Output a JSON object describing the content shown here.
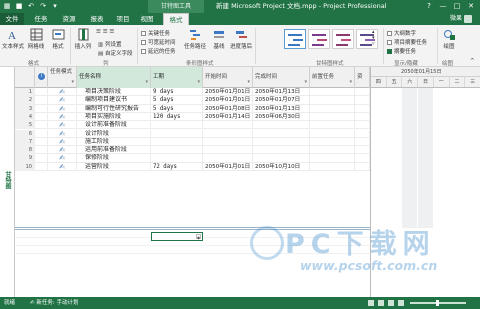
{
  "window": {
    "title": "新建 Microsoft Project 文档.mpp - Project Professional",
    "context_tools": "甘特图工具",
    "controls": [
      "?",
      "—",
      "□",
      "✕"
    ]
  },
  "tabs": [
    {
      "label": "文件"
    },
    {
      "label": "任务"
    },
    {
      "label": "资源"
    },
    {
      "label": "报表"
    },
    {
      "label": "项目"
    },
    {
      "label": "视图"
    },
    {
      "label": "格式"
    }
  ],
  "user": {
    "name": "微果"
  },
  "ribbon": {
    "text_styles": "文本样式",
    "gridlines": "网格线",
    "format": "格式",
    "insert_column": "插入列",
    "column_settings": "列设置",
    "custom_fields": "自定义字段",
    "critical_tasks": "关键任务",
    "slack": "可宽延时间",
    "late_tasks": "延迟的任务",
    "task_path": "任务路径",
    "baseline": "基线",
    "slippage": "进度落后",
    "outline_number": "大纲数字",
    "project_summary": "项目摘要任务",
    "summary_tasks": "摘要任务",
    "drawing": "绘图",
    "groups": {
      "format": "格式",
      "columns": "列",
      "bar_styles": "条形图样式",
      "gantt_styles": "甘特图样式",
      "show_hide": "显示/隐藏",
      "drawings": "绘图"
    },
    "checks": {
      "critical_tasks": false,
      "slack": false,
      "late_tasks": false,
      "outline_number": false,
      "project_summary": false,
      "summary_tasks": true
    }
  },
  "sidebar": {
    "view_label": "甘特图"
  },
  "table": {
    "headers": {
      "mode": "任务模式",
      "name": "任务名称",
      "duration": "工期",
      "start": "开始时间",
      "finish": "完成时间",
      "predecessors": "前置任务",
      "resources": "资"
    },
    "rows": [
      {
        "num": "1",
        "name": "项目决策阶段",
        "duration": "9 days",
        "start": "2050年01月01日",
        "finish": "2050年01月13日"
      },
      {
        "num": "2",
        "name": "编制项目建议书",
        "duration": "5 days",
        "start": "2050年01月01日",
        "finish": "2050年01月07日"
      },
      {
        "num": "3",
        "name": "编制可行性研究报告",
        "duration": "5 days",
        "start": "2050年01月08日",
        "finish": "2050年01月13日"
      },
      {
        "num": "4",
        "name": "项目实施阶段",
        "duration": "120 days",
        "start": "2050年01月14日",
        "finish": "2050年06月30日"
      },
      {
        "num": "5",
        "name": "设计前准备阶段",
        "duration": "",
        "start": "",
        "finish": ""
      },
      {
        "num": "6",
        "name": "设计阶段",
        "duration": "",
        "start": "",
        "finish": ""
      },
      {
        "num": "7",
        "name": "施工阶段",
        "duration": "",
        "start": "",
        "finish": ""
      },
      {
        "num": "8",
        "name": "运用前准备阶段",
        "duration": "",
        "start": "",
        "finish": ""
      },
      {
        "num": "9",
        "name": "保修阶段",
        "duration": "",
        "start": "",
        "finish": ""
      },
      {
        "num": "10",
        "name": "运营阶段",
        "duration": "72 days",
        "start": "2050年01月01日",
        "finish": "2050年10月10日"
      }
    ]
  },
  "gantt": {
    "top_header": "2050年01月15日",
    "day_letters": [
      "四",
      "五",
      "六",
      "日",
      "一",
      "二",
      "三"
    ]
  },
  "status": {
    "ready": "就绪",
    "new_tasks": "新任务: 手动计划"
  },
  "watermark": {
    "text": "PC下载网",
    "url": "www.pcsoft.com.cn"
  },
  "colors": {
    "accent": "#217346",
    "selected_header": "#d2e8db"
  }
}
